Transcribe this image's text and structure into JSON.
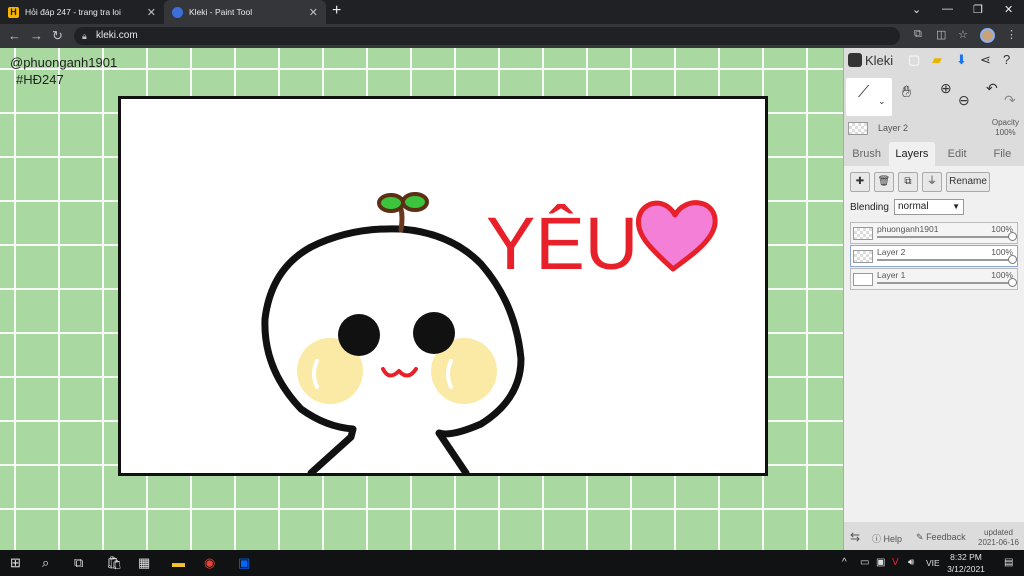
{
  "browser": {
    "tabs": [
      {
        "title": "Hỏi đáp 247 - trang tra loi",
        "favicon": "H"
      },
      {
        "title": "Kleki - Paint Tool",
        "active": true
      }
    ],
    "url": "kleki.com"
  },
  "canvas": {
    "watermark_user": "@phuonganh1901",
    "watermark_tag": "#HĐ247",
    "drawing_text": "YÊU"
  },
  "kleki": {
    "app_name": "Kleki",
    "current_layer": "Layer 2",
    "opacity_label": "Opacity",
    "opacity_value": "100%",
    "tabs": [
      "Brush",
      "Layers",
      "Edit",
      "File"
    ],
    "active_tab": "Layers",
    "rename_label": "Rename",
    "blending_label": "Blending",
    "blending_value": "normal",
    "layers": [
      {
        "name": "phuonganh1901",
        "opacity": "100%"
      },
      {
        "name": "Layer 2",
        "opacity": "100%",
        "selected": true
      },
      {
        "name": "Layer 1",
        "opacity": "100%"
      }
    ],
    "footer": {
      "help": "Help",
      "feedback": "Feedback",
      "updated_label": "updated",
      "updated_date": "2021-06-16"
    }
  },
  "taskbar": {
    "lang": "VIE",
    "time": "8:32 PM",
    "date": "3/12/2021"
  },
  "colors": {
    "workspace_bg": "#a9d8a0",
    "heart_fill": "#f47fd6",
    "heart_stroke": "#e8202a",
    "text_red": "#e8202a",
    "cheek": "#fbeaa6",
    "sprout": "#3cc43c",
    "stem": "#6b3a1e"
  }
}
